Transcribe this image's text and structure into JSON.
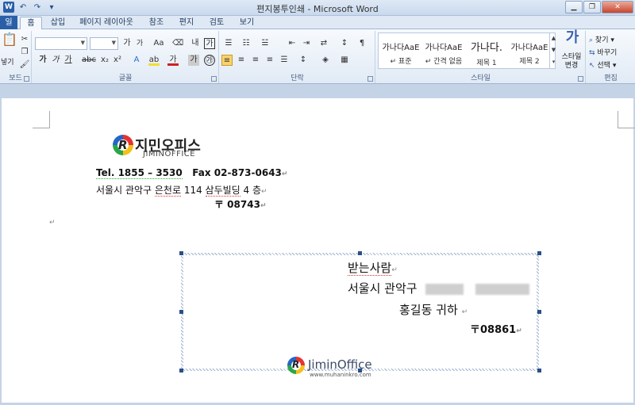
{
  "window": {
    "title": "편지봉투인쇄 - Microsoft Word"
  },
  "qat": {
    "icons": [
      "word-icon",
      "undo-icon",
      "redo-icon",
      "customize-icon"
    ]
  },
  "tabs": [
    {
      "label": "일"
    },
    {
      "label": "홈",
      "active": true
    },
    {
      "label": "삽입"
    },
    {
      "label": "페이지 레이아웃"
    },
    {
      "label": "참조"
    },
    {
      "label": "편지"
    },
    {
      "label": "검토"
    },
    {
      "label": "보기"
    }
  ],
  "ribbon": {
    "clipboard": {
      "paste_label": "붙여넣기",
      "paste_short": "넣기",
      "group": "보드"
    },
    "font": {
      "group": "글꼴",
      "name_value": "",
      "size_value": ""
    },
    "paragraph": {
      "group": "단락"
    },
    "styles": {
      "group": "스타일",
      "items": [
        {
          "sample": "가나다AaE",
          "name": "↵ 표준"
        },
        {
          "sample": "가나다AaE",
          "name": "↵ 간격 없음"
        },
        {
          "sample": "가나다.",
          "name": "제목 1"
        },
        {
          "sample": "가나다AaE",
          "name": "제목 2"
        }
      ],
      "change_label": "스타일 변경"
    },
    "editing": {
      "group": "편집",
      "find": "찾기",
      "replace": "바꾸기",
      "select": "선택"
    }
  },
  "document": {
    "logo_kr": "지민오피스",
    "logo_en": "JIMINOFFICE",
    "line1_tel": "Tel. 1855 – 3530",
    "line1_fax": "Fax 02-873-0643",
    "line2_addr_a": "서울시 관악구 ",
    "line2_addr_b": "은천로",
    "line2_addr_c": " 114 ",
    "line2_addr_d": "삼두빌딩",
    "line2_addr_e": " 4 층",
    "line3_zip": "〒 08743",
    "para_mark": "↵",
    "envelope": {
      "recipient_label": "받는사람",
      "address_prefix": "서울시 관악구",
      "name_line": "홍길동 귀하",
      "zip": "〒08861"
    },
    "watermark": {
      "name": "JiminOffice",
      "url": "www.muhaninkro.com"
    }
  }
}
